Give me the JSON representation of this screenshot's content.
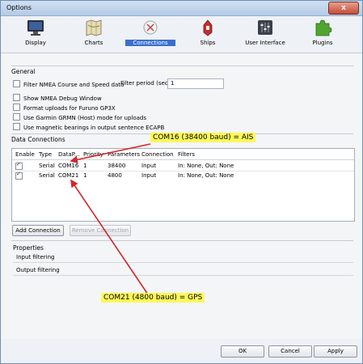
{
  "window": {
    "title": "Options",
    "close_glyph": "x"
  },
  "toolbar": {
    "items": [
      {
        "label": "Display",
        "icon": "monitor-icon"
      },
      {
        "label": "Charts",
        "icon": "chart-icon"
      },
      {
        "label": "Connections",
        "icon": "connections-icon",
        "active": true
      },
      {
        "label": "Ships",
        "icon": "ship-icon"
      },
      {
        "label": "User Interface",
        "icon": "sliders-icon"
      },
      {
        "label": "Plugins",
        "icon": "puzzle-icon"
      }
    ]
  },
  "general": {
    "label": "General",
    "filter_nmea": "Filter NMEA Course and Speed data",
    "filter_period_label": "Filter period (sec)",
    "filter_period_value": "1",
    "options": [
      {
        "label": "Show NMEA Debug Window",
        "checked": false
      },
      {
        "label": "Format uploads for Furuno GP3X",
        "checked": false
      },
      {
        "label": "Use Garmin GRMN (Host) mode for uploads",
        "checked": false
      },
      {
        "label": "Use magnetic bearings in output sentence ECAPB",
        "checked": false
      }
    ]
  },
  "connections": {
    "label": "Data Connections",
    "columns": [
      "Enable",
      "Type",
      "DataP...",
      "Priority",
      "Parameters",
      "Connection",
      "Filters"
    ],
    "rows": [
      {
        "enabled": true,
        "type": "Serial",
        "port": "COM16",
        "priority": "1",
        "parameters": "38400",
        "connection": "Input",
        "filters": "In: None, Out: None"
      },
      {
        "enabled": true,
        "type": "Serial",
        "port": "COM21",
        "priority": "1",
        "parameters": "4800",
        "connection": "Input",
        "filters": "In: None, Out: None"
      }
    ],
    "add_button": "Add Connection",
    "remove_button": "Remove Connection"
  },
  "properties": {
    "label": "Properties",
    "input_filtering": "Input filtering",
    "output_filtering": "Output filtering"
  },
  "footer": {
    "ok": "OK",
    "cancel": "Cancel",
    "apply": "Apply"
  },
  "annotations": {
    "ais": "COM16 (38400 baud) = AIS",
    "gps": "COM21 (4800 baud) = GPS",
    "highlight_color": "#fcf85a",
    "arrow_color": "#d3262a"
  }
}
